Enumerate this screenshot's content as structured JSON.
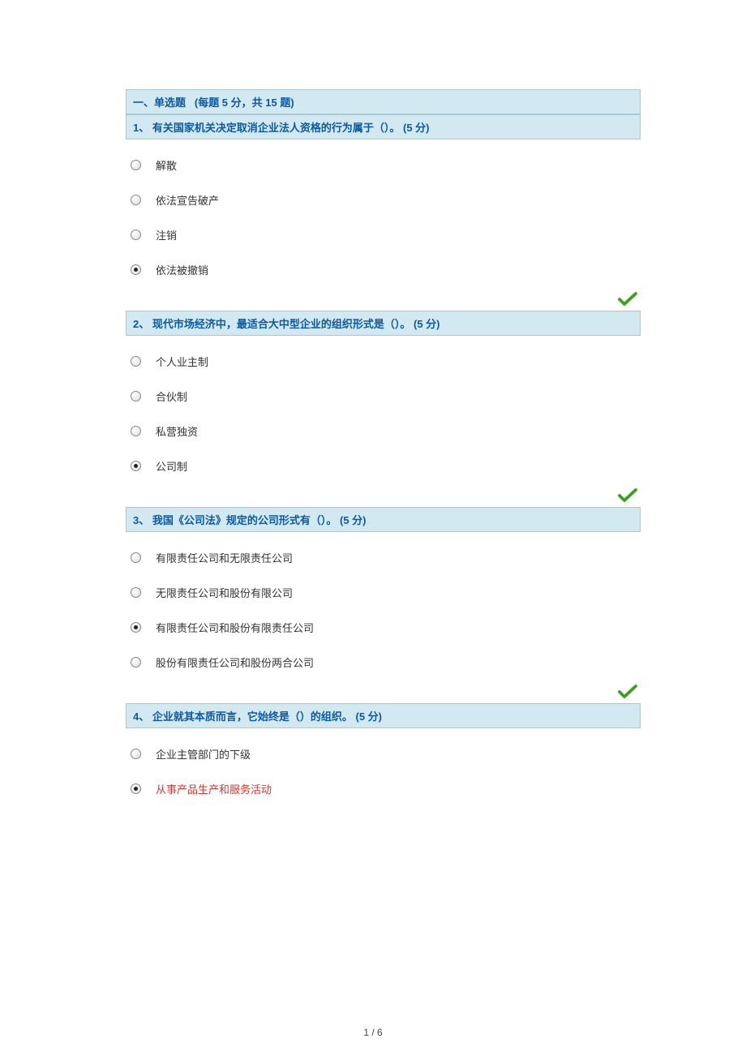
{
  "section": {
    "label_prefix": "一、单选题",
    "label_detail": "(每题 5 分，共 15 题)"
  },
  "questions": [
    {
      "number": "1、",
      "text": "有关国家机关决定取消企业法人资格的行为属于（）。",
      "score": "(5 分)",
      "options": [
        {
          "label": "解散",
          "selected": false
        },
        {
          "label": "依法宣告破产",
          "selected": false
        },
        {
          "label": "注销",
          "selected": false
        },
        {
          "label": "依法被撤销",
          "selected": true
        }
      ],
      "correct": true
    },
    {
      "number": "2、",
      "text": "现代市场经济中，最适合大中型企业的组织形式是（）。",
      "score": "(5 分)",
      "options": [
        {
          "label": "个人业主制",
          "selected": false
        },
        {
          "label": "合伙制",
          "selected": false
        },
        {
          "label": "私营独资",
          "selected": false
        },
        {
          "label": "公司制",
          "selected": true
        }
      ],
      "correct": true
    },
    {
      "number": "3、",
      "text": "我国《公司法》规定的公司形式有（）。",
      "score": "(5 分)",
      "options": [
        {
          "label": "有限责任公司和无限责任公司",
          "selected": false
        },
        {
          "label": "无限责任公司和股份有限公司",
          "selected": false
        },
        {
          "label": "有限责任公司和股份有限责任公司",
          "selected": true
        },
        {
          "label": "股份有限责任公司和股份两合公司",
          "selected": false
        }
      ],
      "correct": true
    },
    {
      "number": "4、",
      "text": "企业就其本质而言，它始终是（）的组织。",
      "score": "(5 分)",
      "options": [
        {
          "label": "企业主管部门的下级",
          "selected": false
        },
        {
          "label": "从事产品生产和服务活动",
          "selected": true,
          "highlight": true
        }
      ],
      "correct": null
    }
  ],
  "page_number": "1 / 6"
}
